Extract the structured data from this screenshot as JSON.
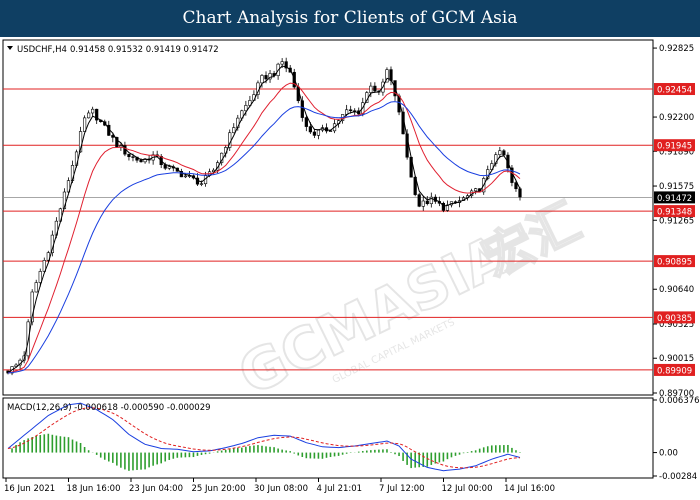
{
  "header": {
    "title": "Chart Analysis for Clients of GCM Asia"
  },
  "watermark": {
    "brand": "GCMASIA",
    "chinese": "宏汇",
    "tagline": "GLOBAL CAPITAL MARKETS"
  },
  "colors": {
    "title_bg": "#0f3f63",
    "candle": "#000000",
    "level_line": "#e02020",
    "price_label_bg": "#e02020",
    "current_price_bg": "#000000",
    "ma_fast": "#000000",
    "ma_mid": "#e02030",
    "ma_slow": "#1a3fe0",
    "macd_hist": "#2e9e2e",
    "macd_line": "#1a3fe0",
    "macd_signal": "#e02020"
  },
  "chart_data": [
    {
      "type": "candlestick",
      "title": "USDCHF,H4",
      "ohlc_readout": [
        "0.91458",
        "0.91532",
        "0.91419",
        "0.91472"
      ],
      "ylim": [
        0.897,
        0.9288
      ],
      "y_ticks": [
        "0.92825",
        "0.92200",
        "0.91890",
        "0.91575",
        "0.91265",
        "0.90640",
        "0.90325",
        "0.90015",
        "0.89700"
      ],
      "x_ticks": [
        "16 Jun 2021",
        "18 Jun 16:00",
        "23 Jun 04:00",
        "25 Jun 20:00",
        "30 Jun 08:00",
        "4 Jul 21:01",
        "7 Jul 12:00",
        "12 Jul 00:00",
        "14 Jul 16:00"
      ],
      "levels": [
        0.92454,
        0.91945,
        0.91348,
        0.90895,
        0.90385,
        0.89909
      ],
      "level_labels": [
        "0.92454",
        "0.91945",
        "0.91348",
        "0.90895",
        "0.90385",
        "0.89909"
      ],
      "current_price": 0.91472,
      "current_label": "0.91472",
      "anchors": [
        [
          0,
          0.899
        ],
        [
          2,
          0.8995
        ],
        [
          4,
          0.9005
        ],
        [
          6,
          0.906
        ],
        [
          10,
          0.91
        ],
        [
          14,
          0.915
        ],
        [
          17,
          0.919
        ],
        [
          19,
          0.9218
        ],
        [
          21,
          0.9225
        ],
        [
          24,
          0.921
        ],
        [
          27,
          0.9195
        ],
        [
          30,
          0.9185
        ],
        [
          33,
          0.918
        ],
        [
          36,
          0.9185
        ],
        [
          39,
          0.9175
        ],
        [
          42,
          0.917
        ],
        [
          45,
          0.9165
        ],
        [
          48,
          0.916
        ],
        [
          51,
          0.9172
        ],
        [
          54,
          0.9195
        ],
        [
          57,
          0.922
        ],
        [
          60,
          0.9235
        ],
        [
          63,
          0.9255
        ],
        [
          66,
          0.926
        ],
        [
          68,
          0.927
        ],
        [
          70,
          0.926
        ],
        [
          72,
          0.9235
        ],
        [
          74,
          0.921
        ],
        [
          76,
          0.9205
        ],
        [
          80,
          0.921
        ],
        [
          84,
          0.9225
        ],
        [
          87,
          0.9225
        ],
        [
          90,
          0.925
        ],
        [
          92,
          0.924
        ],
        [
          94,
          0.9262
        ],
        [
          96,
          0.924
        ],
        [
          98,
          0.9205
        ],
        [
          100,
          0.9165
        ],
        [
          102,
          0.914
        ],
        [
          105,
          0.9145
        ],
        [
          108,
          0.9138
        ],
        [
          111,
          0.9142
        ],
        [
          114,
          0.9148
        ],
        [
          117,
          0.9155
        ],
        [
          119,
          0.917
        ],
        [
          121,
          0.9188
        ],
        [
          123,
          0.9185
        ],
        [
          125,
          0.916
        ],
        [
          127,
          0.9147
        ]
      ]
    },
    {
      "type": "line",
      "title": "MACD(12,26,9)",
      "readout": [
        "-0.000618",
        "-0.000590",
        "-0.000029"
      ],
      "ylim": [
        -0.00284,
        0.006376
      ],
      "y_ticks": [
        "0.006376",
        "0.00",
        "-0.00284"
      ],
      "anchors": [
        [
          0,
          0.0005
        ],
        [
          5,
          0.0025
        ],
        [
          10,
          0.0045
        ],
        [
          15,
          0.0058
        ],
        [
          18,
          0.006
        ],
        [
          22,
          0.0052
        ],
        [
          26,
          0.004
        ],
        [
          30,
          0.0022
        ],
        [
          34,
          0.001
        ],
        [
          38,
          0.0005
        ],
        [
          42,
          0.0004
        ],
        [
          46,
          0.0001
        ],
        [
          50,
          0.0002
        ],
        [
          54,
          0.0006
        ],
        [
          58,
          0.0011
        ],
        [
          62,
          0.0018
        ],
        [
          66,
          0.0021
        ],
        [
          70,
          0.002
        ],
        [
          74,
          0.0012
        ],
        [
          78,
          0.0007
        ],
        [
          82,
          0.0006
        ],
        [
          86,
          0.0008
        ],
        [
          90,
          0.0011
        ],
        [
          94,
          0.0014
        ],
        [
          97,
          0.0008
        ],
        [
          100,
          -0.0008
        ],
        [
          104,
          -0.0018
        ],
        [
          108,
          -0.0022
        ],
        [
          112,
          -0.002
        ],
        [
          116,
          -0.0016
        ],
        [
          120,
          -0.0008
        ],
        [
          124,
          -0.0002
        ],
        [
          127,
          -0.0006
        ]
      ]
    }
  ]
}
